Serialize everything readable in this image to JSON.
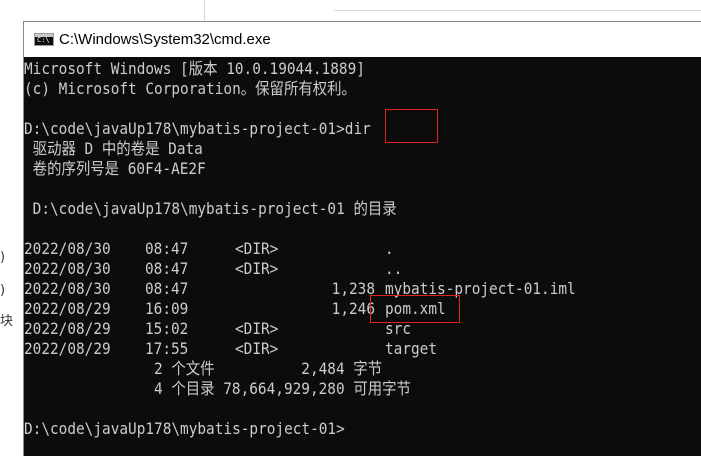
{
  "background_app": {
    "fragments": [
      ")",
      ")",
      "块"
    ]
  },
  "window": {
    "title": "C:\\Windows\\System32\\cmd.exe",
    "icon_label": "C:\\"
  },
  "console": {
    "header_line1": "Microsoft Windows [版本 10.0.19044.1889]",
    "header_line2": "(c) Microsoft Corporation。保留所有权利。",
    "prompt1": "D:\\code\\javaUp178\\mybatis-project-01>",
    "command": "dir",
    "volume_line": " 驱动器 D 中的卷是 Data",
    "serial_line": " 卷的序列号是 60F4-AE2F",
    "dir_of_line": " D:\\code\\javaUp178\\mybatis-project-01 的目录",
    "entries": [
      {
        "date": "2022/08/30",
        "time": "08:47",
        "type": "<DIR>",
        "size": "",
        "name": "."
      },
      {
        "date": "2022/08/30",
        "time": "08:47",
        "type": "<DIR>",
        "size": "",
        "name": ".."
      },
      {
        "date": "2022/08/30",
        "time": "08:47",
        "type": "",
        "size": "1,238",
        "name": "mybatis-project-01.iml"
      },
      {
        "date": "2022/08/29",
        "time": "16:09",
        "type": "",
        "size": "1,246",
        "name": "pom.xml"
      },
      {
        "date": "2022/08/29",
        "time": "15:02",
        "type": "<DIR>",
        "size": "",
        "name": "src"
      },
      {
        "date": "2022/08/29",
        "time": "17:55",
        "type": "<DIR>",
        "size": "",
        "name": "target"
      }
    ],
    "summary_files": "               2 个文件          2,484 字节",
    "summary_dirs": "               4 个目录 78,664,929,280 可用字节",
    "prompt2": "D:\\code\\javaUp178\\mybatis-project-01>",
    "text_color": "#cccccc",
    "background_color": "#0c0c0c",
    "highlight_color": "#e0221c"
  }
}
